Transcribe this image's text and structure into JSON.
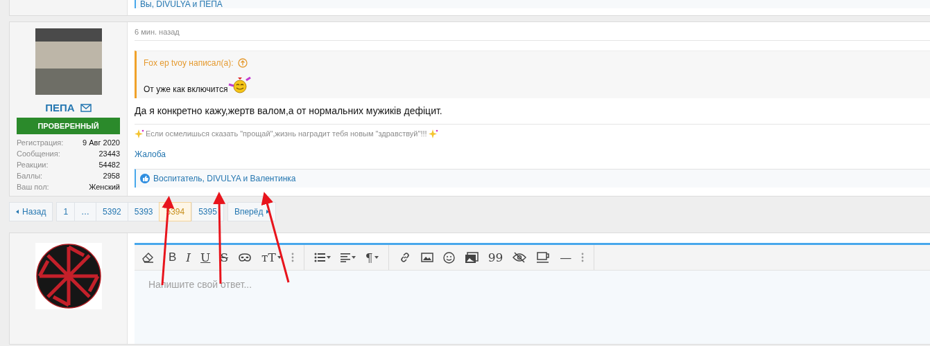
{
  "previous_post": {
    "reactions": "Вы, DIVULYA и ПЕПА"
  },
  "post": {
    "author": {
      "name": "ПЕПА",
      "badge": "ПРОВЕРЕННЫЙ",
      "stats": [
        {
          "label": "Регистрация:",
          "value": "9 Авг 2020"
        },
        {
          "label": "Сообщения:",
          "value": "23443"
        },
        {
          "label": "Реакции:",
          "value": "54482"
        },
        {
          "label": "Баллы:",
          "value": "2958"
        },
        {
          "label": "Ваш пол:",
          "value": "Женский"
        }
      ]
    },
    "time": "6 мин. назад",
    "quote": {
      "author": "Fox ep tvoy написал(а):",
      "text": "От уже как включится"
    },
    "body": "Да я конкретно кажу,жертв валом,а от нормальних мужиків дефіцит.",
    "signature": "Если осмелишься сказать \"прощай\",жизнь наградит тебя новым \"здравствуй\"!!!",
    "report": "Жалоба",
    "reactions": "Воспитатель, DIVULYA и Валентинка"
  },
  "pagination": {
    "prev": "Назад",
    "next": "Вперёд",
    "pages": [
      {
        "label": "1",
        "selected": false
      },
      {
        "label": "…",
        "selected": false
      },
      {
        "label": "5392",
        "selected": false
      },
      {
        "label": "5393",
        "selected": false
      },
      {
        "label": "5394",
        "selected": true
      },
      {
        "label": "5395",
        "selected": false
      }
    ]
  },
  "editor": {
    "toolbar": [
      {
        "kind": "eraser"
      },
      {
        "kind": "glyph",
        "label": "B"
      },
      {
        "kind": "glyph",
        "label": "I"
      },
      {
        "kind": "glyph",
        "label": "U"
      },
      {
        "kind": "glyph",
        "label": "S"
      },
      {
        "kind": "mask"
      },
      {
        "kind": "glyph",
        "label": "тT",
        "dropdown": true
      },
      {
        "kind": "more"
      },
      {
        "kind": "sep"
      },
      {
        "kind": "list",
        "dropdown": true
      },
      {
        "kind": "align",
        "dropdown": true
      },
      {
        "kind": "glyph",
        "label": "¶",
        "dropdown": true
      },
      {
        "kind": "sep"
      },
      {
        "kind": "link"
      },
      {
        "kind": "image"
      },
      {
        "kind": "smile"
      },
      {
        "kind": "gallery"
      },
      {
        "kind": "glyph",
        "label": "99"
      },
      {
        "kind": "eye"
      },
      {
        "kind": "cup"
      },
      {
        "kind": "glyph",
        "label": "—"
      },
      {
        "kind": "more"
      },
      {
        "kind": "sep"
      }
    ],
    "placeholder": "Напишите свой ответ..."
  }
}
